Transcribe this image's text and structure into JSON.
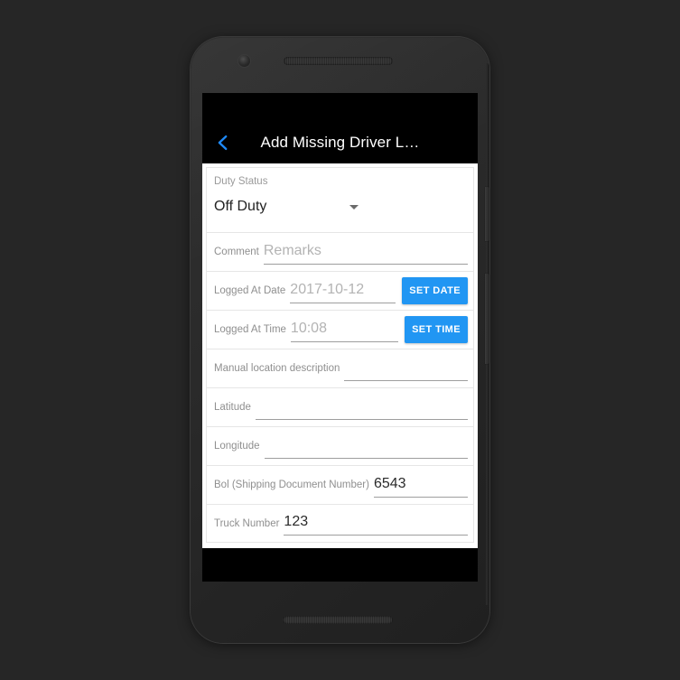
{
  "device": {
    "type": "android-phone",
    "body_color": "#2b2b2b",
    "background_color": "#262626",
    "camera_icon": "camera-dot",
    "speaker_icon": "speaker-grille"
  },
  "appbar": {
    "background_color": "#000000",
    "back_icon": "chevron-left-icon",
    "back_icon_color": "#1e88f5",
    "title": "Add Missing Driver L…"
  },
  "theme": {
    "accent": "#2196f3",
    "label_color": "#8f8f8f",
    "placeholder_color": "#b3b3b3",
    "value_color": "#2a2a2a",
    "card_background": "#ffffff",
    "row_border": "#e6e6e6"
  },
  "form": {
    "duty_status": {
      "label": "Duty Status",
      "value": "Off Duty",
      "caret_icon": "dropdown-caret-icon",
      "options": [
        "Off Duty"
      ]
    },
    "fields": [
      {
        "key": "comment",
        "label": "Comment",
        "placeholder": "Remarks",
        "value": "",
        "filled": false,
        "button": null
      },
      {
        "key": "logged_at_date",
        "label": "Logged At Date",
        "placeholder": "2017-10-12",
        "value": "",
        "filled": false,
        "button": "SET DATE"
      },
      {
        "key": "logged_at_time",
        "label": "Logged At Time",
        "placeholder": "10:08",
        "value": "",
        "filled": false,
        "button": "SET TIME"
      },
      {
        "key": "manual_location_description",
        "label": "Manual location description",
        "placeholder": "",
        "value": "",
        "filled": false,
        "button": null
      },
      {
        "key": "latitude",
        "label": "Latitude",
        "placeholder": "",
        "value": "",
        "filled": false,
        "button": null
      },
      {
        "key": "longitude",
        "label": "Longitude",
        "placeholder": "",
        "value": "",
        "filled": false,
        "button": null
      },
      {
        "key": "bol",
        "label": "Bol (Shipping Document Number)",
        "placeholder": "",
        "value": "6543",
        "filled": true,
        "button": null
      },
      {
        "key": "truck_number",
        "label": "Truck Number",
        "placeholder": "",
        "value": "123",
        "filled": true,
        "button": null
      }
    ]
  }
}
